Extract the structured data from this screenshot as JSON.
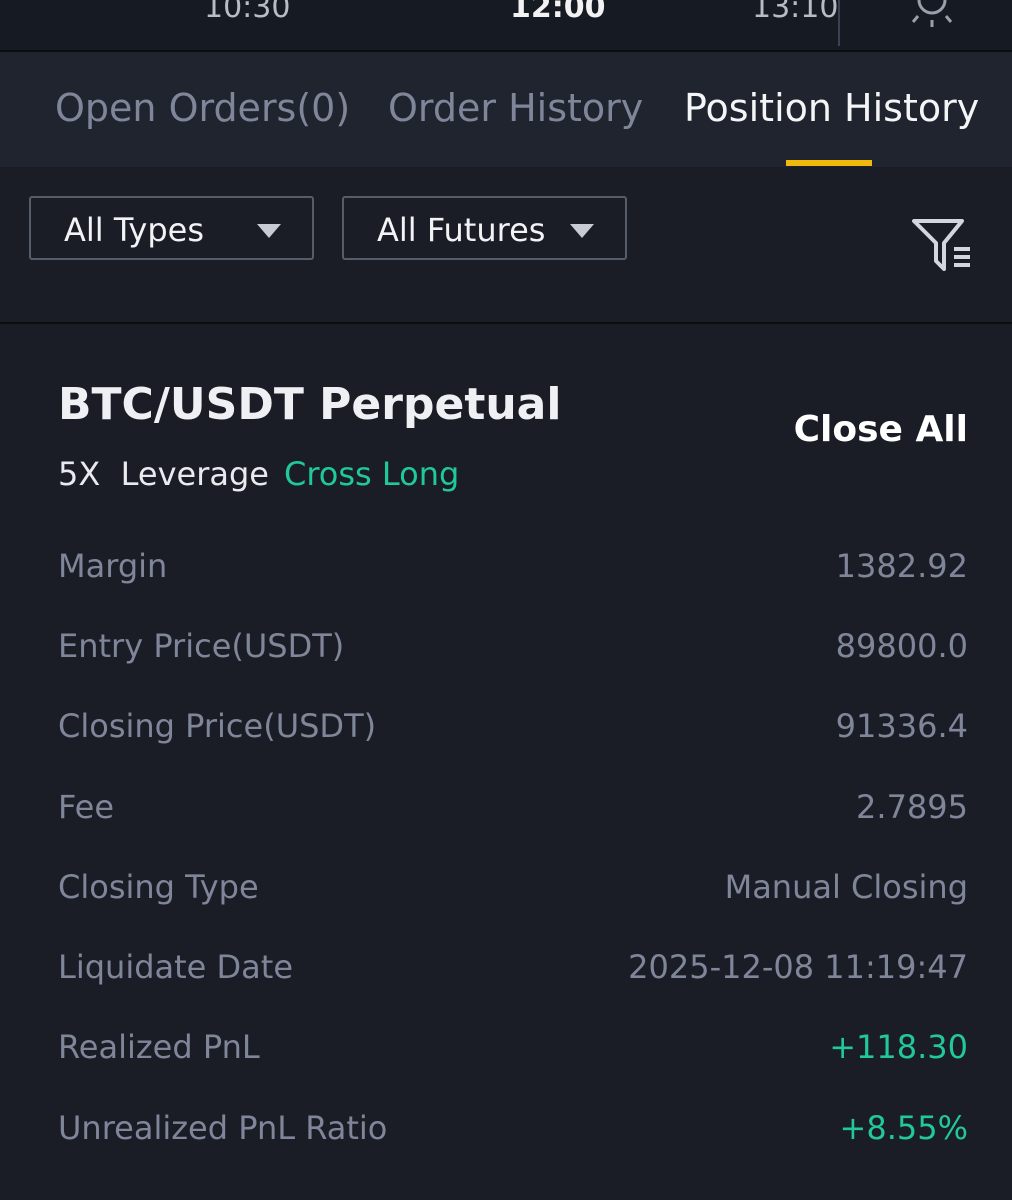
{
  "timeline": {
    "times": [
      {
        "label": "10:30",
        "bold": false
      },
      {
        "label": "12:00",
        "bold": true
      },
      {
        "label": "13:10",
        "bold": false
      }
    ]
  },
  "tabs": [
    {
      "label": "Open Orders(0)",
      "active": false
    },
    {
      "label": "Order History",
      "active": false
    },
    {
      "label": "Position History",
      "active": true
    }
  ],
  "filters": {
    "types": "All Types",
    "futures": "All Futures"
  },
  "position": {
    "pair": "BTC/USDT Perpetual",
    "close_all": "Close All",
    "leverage": "5X  Leverage",
    "side": "Cross Long",
    "rows": [
      {
        "label": "Margin",
        "value": "1382.92",
        "positive": false
      },
      {
        "label": "Entry Price(USDT)",
        "value": "89800.0",
        "positive": false
      },
      {
        "label": "Closing Price(USDT)",
        "value": "91336.4",
        "positive": false
      },
      {
        "label": "Fee",
        "value": "2.7895",
        "positive": false
      },
      {
        "label": "Closing Type",
        "value": "Manual Closing",
        "positive": false
      },
      {
        "label": "Liquidate Date",
        "value": "2025-12-08 11:19:47",
        "positive": false
      },
      {
        "label": "Realized PnL",
        "value": "+118.30",
        "positive": true
      },
      {
        "label": "Unrealized PnL Ratio",
        "value": "+8.55%",
        "positive": true
      }
    ]
  },
  "colors": {
    "background": "#1a1d26",
    "tab_bar": "#20242e",
    "accent": "#f0b90b",
    "positive": "#20c997",
    "muted_text": "#80869a"
  },
  "icons": {
    "timeline": "sun-icon",
    "filter": "filter-list-icon",
    "dropdown": "caret-down-icon"
  }
}
